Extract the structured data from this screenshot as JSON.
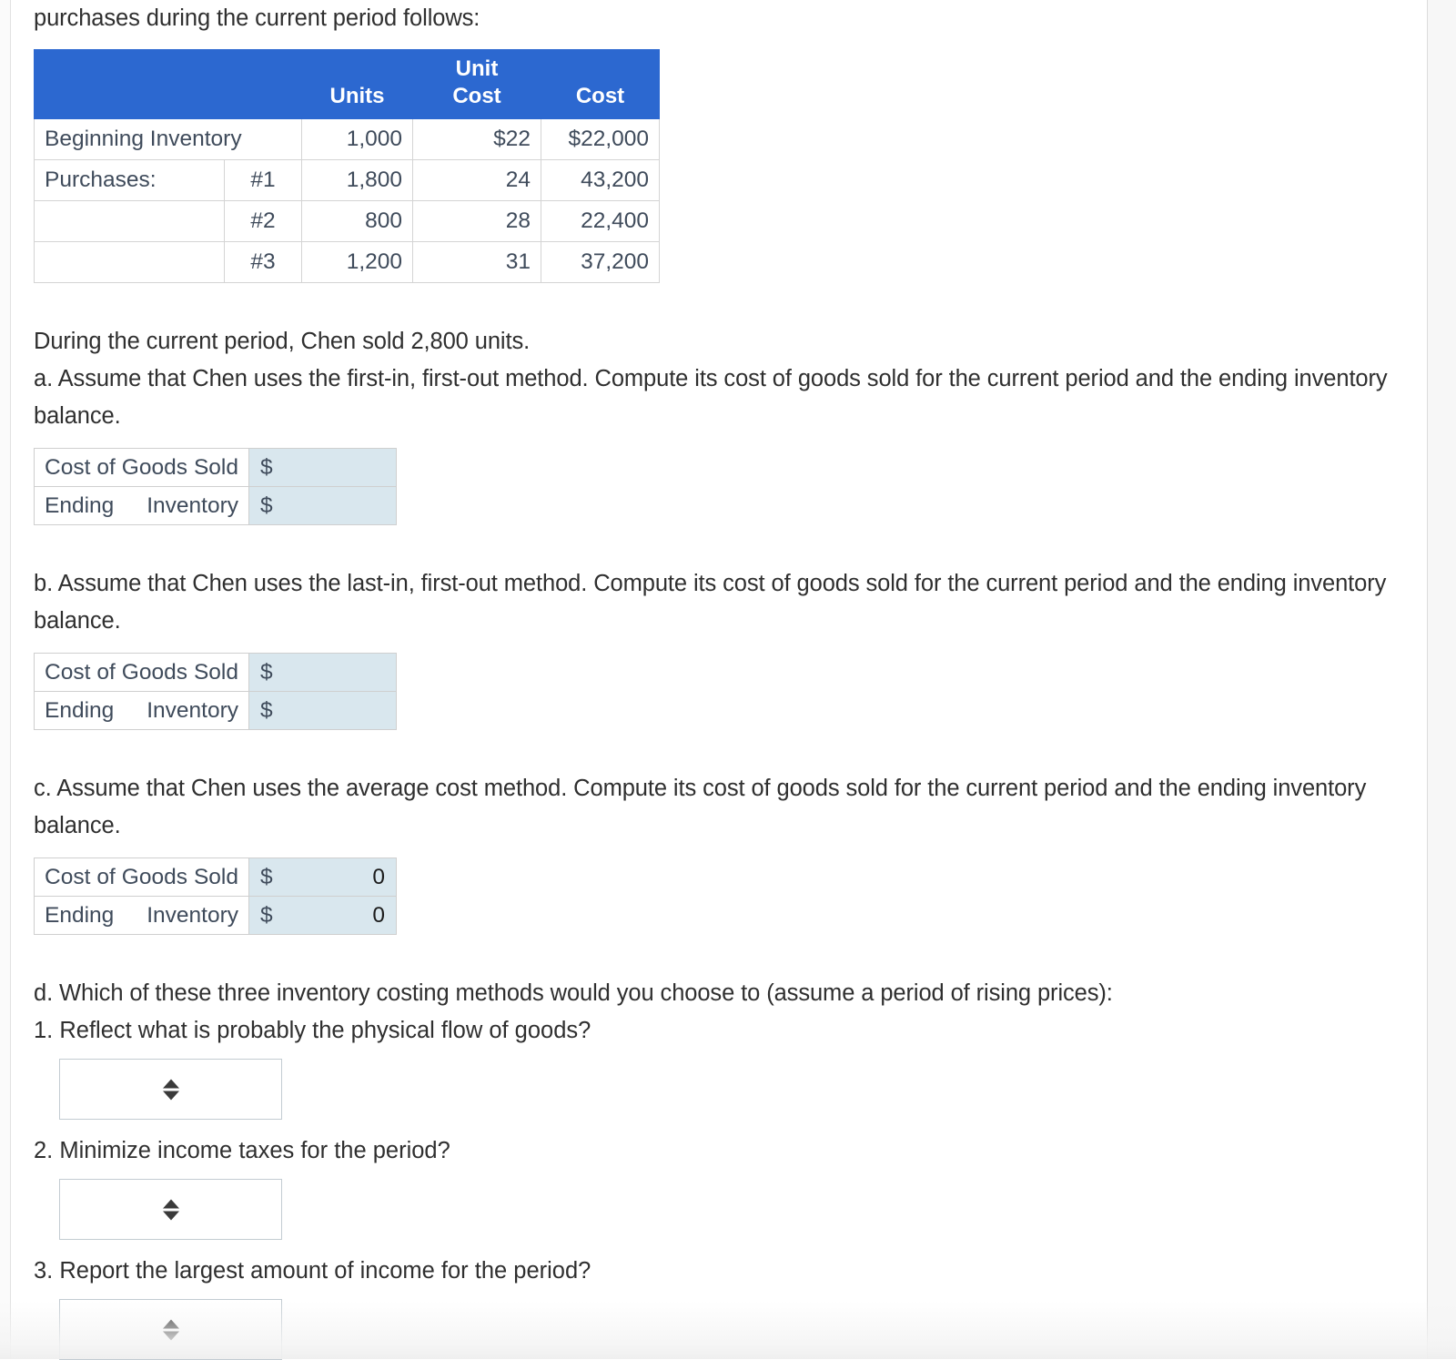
{
  "intro": {
    "lead_text": "purchases during the current period follows:"
  },
  "inventory_table": {
    "headers": {
      "blank": "",
      "blank2": "",
      "units": "Units",
      "unit_cost_line1": "Unit",
      "unit_cost_line2": "Cost",
      "cost": "Cost"
    },
    "rows": [
      {
        "name": "Beginning Inventory",
        "purchase_no": "",
        "units": "1,000",
        "unit_cost": "$22",
        "cost": "$22,000"
      },
      {
        "name": "Purchases:",
        "purchase_no": "#1",
        "units": "1,800",
        "unit_cost": "24",
        "cost": "43,200"
      },
      {
        "name": "",
        "purchase_no": "#2",
        "units": "800",
        "unit_cost": "28",
        "cost": "22,400"
      },
      {
        "name": "",
        "purchase_no": "#3",
        "units": "1,200",
        "unit_cost": "31",
        "cost": "37,200"
      }
    ]
  },
  "sold_statement": "During the current period, Chen sold 2,800 units.",
  "parts": {
    "a": {
      "prompt": "a. Assume that Chen uses the first-in, first-out method. Compute its cost of goods sold for the current period and the ending inventory balance.",
      "rows": [
        {
          "label": "Cost of Goods Sold",
          "currency": "$",
          "value": ""
        },
        {
          "label": "Ending Inventory",
          "currency": "$",
          "value": ""
        }
      ]
    },
    "b": {
      "prompt": "b. Assume that Chen uses the last-in, first-out method. Compute its cost of goods sold for the current period and the ending inventory balance.",
      "rows": [
        {
          "label": "Cost of Goods Sold",
          "currency": "$",
          "value": ""
        },
        {
          "label": "Ending Inventory",
          "currency": "$",
          "value": ""
        }
      ]
    },
    "c": {
      "prompt": "c. Assume that Chen uses the average cost method. Compute its cost of goods sold for the current period and the ending inventory balance.",
      "rows": [
        {
          "label": "Cost of Goods Sold",
          "currency": "$",
          "value": "0"
        },
        {
          "label": "Ending Inventory",
          "currency": "$",
          "value": "0"
        }
      ]
    },
    "d": {
      "prompt": "d. Which of these three inventory costing methods would you choose to (assume a period of rising prices):",
      "questions": [
        {
          "text": "1. Reflect what is probably the physical flow of goods?",
          "selected": ""
        },
        {
          "text": "2. Minimize income taxes for the period?",
          "selected": ""
        },
        {
          "text": "3. Report the largest amount of income for the period?",
          "selected": ""
        }
      ]
    }
  },
  "colors": {
    "header_blue": "#2C68D0",
    "input_fill": "#D9E7EE",
    "label_text": "#3F4B5B",
    "body_text": "#2F2F2F",
    "cell_border": "#D4D4D4"
  },
  "icons": {
    "spinner": "updown-spinner-icon"
  }
}
